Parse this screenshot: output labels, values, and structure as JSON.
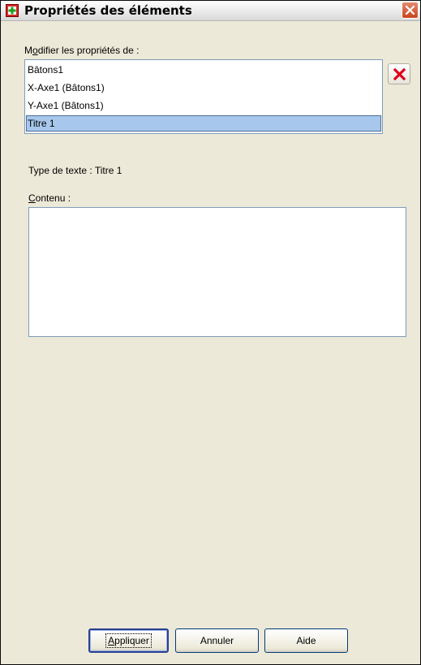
{
  "window": {
    "title": "Propriétés des éléments",
    "icon": "chart-properties-icon",
    "close_icon": "close-icon"
  },
  "edit_properties": {
    "label_accel": "o",
    "label_pre": "M",
    "label_post": "difier les propriétés de :",
    "items": [
      {
        "label": "Bâtons1",
        "selected": false
      },
      {
        "label": "X-Axe1 (Bâtons1)",
        "selected": false
      },
      {
        "label": "Y-Axe1 (Bâtons1)",
        "selected": false
      },
      {
        "label": "Titre 1",
        "selected": true
      }
    ],
    "delete_icon": "delete-x-icon"
  },
  "text_type": {
    "label": "Type de texte : Titre 1"
  },
  "content": {
    "label_accel": "C",
    "label_post": "ontenu :",
    "value": ""
  },
  "buttons": {
    "apply_accel": "A",
    "apply_post": "ppliquer",
    "cancel": "Annuler",
    "help": "Aide"
  }
}
